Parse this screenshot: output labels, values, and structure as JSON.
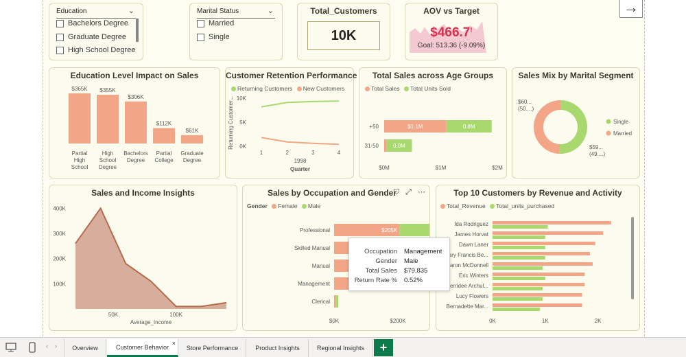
{
  "slicers": {
    "education": {
      "title": "Education",
      "options": [
        "Bachelors Degree",
        "Graduate Degree",
        "High School Degree"
      ]
    },
    "marital": {
      "title": "Marital Status",
      "options": [
        "Married",
        "Single"
      ]
    }
  },
  "kpis": {
    "total_customers": {
      "title": "Total_Customers",
      "value": "10K"
    },
    "aov": {
      "title": "AOV vs Target",
      "value": "$466.7",
      "mark": "!",
      "goal": "Goal: 513.36 (-9.09%)"
    }
  },
  "nav_arrow": "→",
  "colors": {
    "salmon": "#f2a587",
    "green": "#a8d86e",
    "area": "#c9947f",
    "area_line": "#b66a4e",
    "accent": "#0c7b4c"
  },
  "charts": {
    "education_sales": {
      "title": "Education Level Impact on Sales",
      "chart_data": {
        "type": "bar",
        "categories": [
          "Partial High School",
          "High School Degree",
          "Bachelors Degree",
          "Partial College",
          "Graduate Degree"
        ],
        "values": [
          365,
          355,
          306,
          112,
          61
        ],
        "labels": [
          "$365K",
          "$355K",
          "$306K",
          "$112K",
          "$61K"
        ],
        "ylim": [
          0,
          400
        ]
      },
      "cat_lines": [
        [
          "Partial",
          "High",
          "School"
        ],
        [
          "High",
          "School",
          "Degree"
        ],
        [
          "Bachelors",
          "Degree"
        ],
        [
          "Partial",
          "College"
        ],
        [
          "Graduate",
          "Degree"
        ]
      ]
    },
    "retention": {
      "title": "Customer Retention Performance",
      "legend": [
        "Returning Customers",
        "New Customers"
      ],
      "chart_data": {
        "type": "line",
        "x": [
          "1",
          "2",
          "3",
          "4"
        ],
        "series": [
          {
            "name": "Returning Customers",
            "values": [
              8200,
              9100,
              9300,
              9400
            ]
          },
          {
            "name": "New Customers",
            "values": [
              1800,
              900,
              600,
              400
            ]
          }
        ],
        "ylim": [
          0,
          10000
        ],
        "xlabel": "Quarter",
        "year": "1998",
        "ylabel": "Returning Customer..."
      },
      "yticks": [
        "10K",
        "5K",
        "0K"
      ]
    },
    "age_groups": {
      "title": "Total Sales across Age Groups",
      "legend": [
        "Total Sales",
        "Total Units Sold"
      ],
      "chart_data": {
        "type": "bar",
        "categories": [
          "+50",
          "31-50"
        ],
        "series": [
          {
            "name": "Total Sales",
            "values": [
              1.1,
              0.04
            ],
            "labels": [
              "$1.1M",
              ""
            ]
          },
          {
            "name": "Total Units Sold",
            "values": [
              0.8,
              0.45
            ],
            "labels": [
              "0.8M",
              "0.0M"
            ]
          }
        ],
        "xlim": [
          0,
          2
        ]
      },
      "xticks": [
        "$0M",
        "$1M",
        "$2M"
      ]
    },
    "marital_mix": {
      "title": "Sales Mix by Marital Segment",
      "chart_data": {
        "type": "pie",
        "categories": [
          "Single",
          "Married"
        ],
        "values": [
          50,
          49
        ]
      },
      "labels": [
        [
          "$59...",
          "(49....)"
        ],
        [
          "$60...",
          "(50....)"
        ]
      ]
    },
    "income": {
      "title": "Sales and Income Insights",
      "chart_data": {
        "type": "area",
        "x": [
          20000,
          40000,
          60000,
          80000,
          100000,
          120000,
          140000
        ],
        "y": [
          260000,
          400000,
          180000,
          110000,
          10000,
          10000,
          25000
        ],
        "xlabel": "Average_Income",
        "ylim": [
          0,
          420000
        ]
      },
      "yticks": [
        "400K",
        "300K",
        "200K",
        "100K"
      ],
      "xticks": [
        "50K",
        "100K"
      ]
    },
    "occupation": {
      "title": "Sales by Occupation and Gender",
      "legend_title": "Gender",
      "legend": [
        "Female",
        "Male"
      ],
      "chart_data": {
        "type": "bar",
        "categories": [
          "Professional",
          "Skilled Manual",
          "Manual",
          "Management",
          "Clerical"
        ],
        "series": [
          {
            "name": "Female",
            "values": [
              205,
              163,
              141,
              93,
              5
            ],
            "labels": [
              "$205K",
              "$163K",
              "$141K",
              "$93K",
              ""
            ]
          },
          {
            "name": "Male",
            "values": [
              183,
              80,
              80,
              80,
              8
            ],
            "labels": [
              "$183K",
              "",
              "",
              "$80K",
              ""
            ]
          }
        ],
        "xlim": [
          0,
          400
        ]
      },
      "xticks": [
        "$0K",
        "$200K",
        "$400K"
      ],
      "tooltip": [
        [
          "Occupation",
          "Management"
        ],
        [
          "Gender",
          "Male"
        ],
        [
          "Total Sales",
          "$79,835"
        ],
        [
          "Return Rate %",
          "0.52%"
        ]
      ]
    },
    "top_customers": {
      "title": "Top 10 Customers by Revenue and Activity",
      "legend": [
        "Total_Revenue",
        "Total_units_purchased"
      ],
      "chart_data": {
        "type": "bar",
        "categories": [
          "Ida Rodriguez",
          "James Horvat",
          "Dawn Laner",
          "Mary Francis Be...",
          "Sharon McDonnell",
          "Eric Winters",
          "Kerridee Archul...",
          "Lucy Flowers",
          "Bernadette Mar..."
        ],
        "series": [
          {
            "name": "Total_Revenue",
            "values": [
              2.25,
              2.1,
              1.95,
              1.85,
              1.9,
              1.75,
              1.75,
              1.7,
              1.7
            ]
          },
          {
            "name": "Total_units_purchased",
            "values": [
              1.05,
              1.0,
              1.0,
              1.0,
              0.95,
              1.0,
              0.95,
              0.95,
              0.9
            ]
          }
        ],
        "xlim": [
          0,
          2.8
        ]
      },
      "xticks": [
        "0K",
        "1K",
        "2K"
      ]
    }
  },
  "tabs": [
    "Overview",
    "Customer Behavior",
    "Store Performance",
    "Product Insights",
    "Regional Insights"
  ],
  "active_tab": "Customer Behavior",
  "add_tab": "+",
  "close_tab": "×"
}
